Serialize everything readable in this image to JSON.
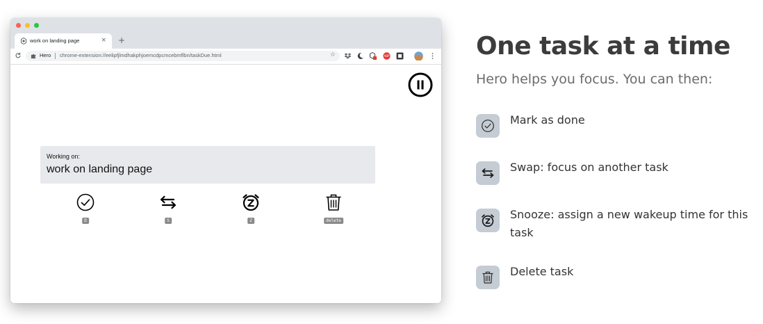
{
  "browser": {
    "tab_title": "work on landing page",
    "tab_close": "×",
    "new_tab": "+",
    "site_name": "Hero",
    "url": "chrome-extension://eelipfjlmdhakphjoemcdpcmcebmflbn/taskDue.html",
    "star": "☆"
  },
  "app": {
    "working_label": "Working on:",
    "task_name": "work on landing page",
    "actions": [
      {
        "name": "done",
        "shortcut": "D"
      },
      {
        "name": "swap",
        "shortcut": "S"
      },
      {
        "name": "snooze",
        "shortcut": "Z"
      },
      {
        "name": "delete",
        "shortcut": "delete"
      }
    ]
  },
  "promo": {
    "heading": "One task at a time",
    "subheading": "Hero helps you focus. You can then:",
    "features": [
      {
        "icon": "check-circle-icon",
        "text": "Mark as done"
      },
      {
        "icon": "swap-arrows-icon",
        "text": "Swap: focus on another task"
      },
      {
        "icon": "alarm-snooze-icon",
        "text": "Snooze: assign a new wakeup time for this task"
      },
      {
        "icon": "trash-icon",
        "text": "Delete task"
      }
    ]
  },
  "colors": {
    "feature_icon_bg": "#c5ccd3",
    "heading": "#3c3c3c",
    "subheading": "#6b6b6b"
  }
}
